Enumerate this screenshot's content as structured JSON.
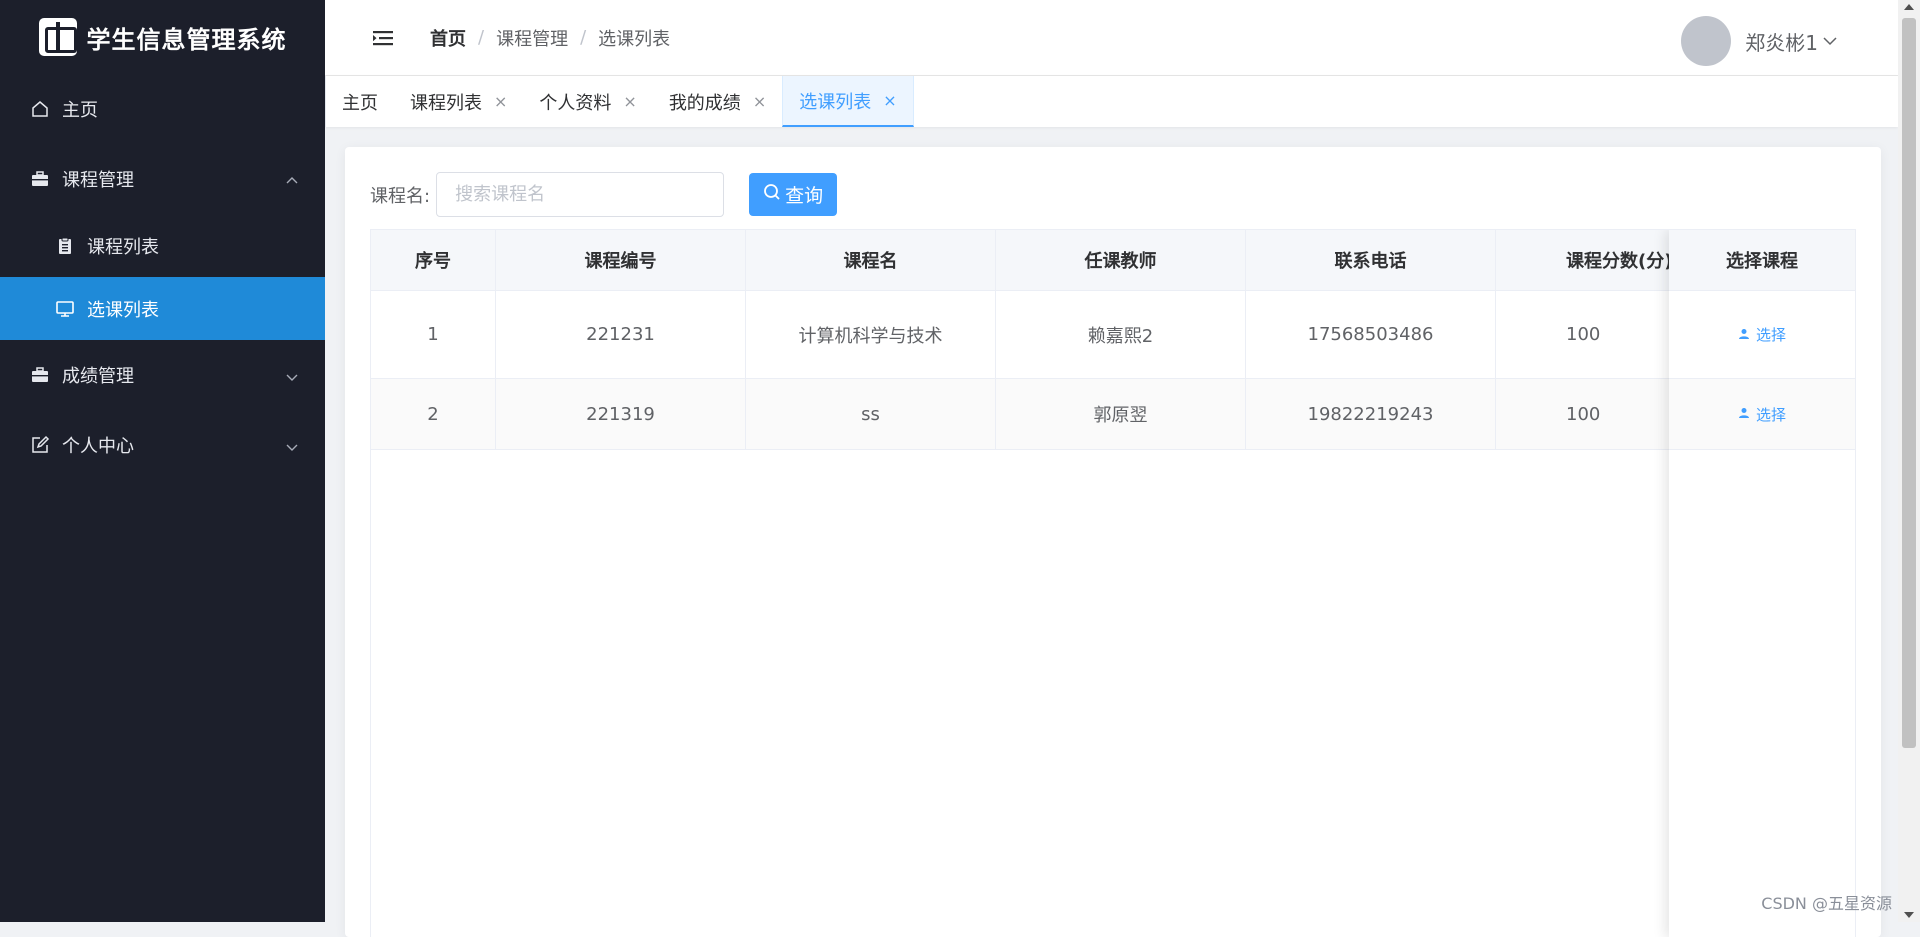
{
  "app": {
    "title": "学生信息管理系统",
    "logo_icon": "school-logo-icon"
  },
  "sidebar": {
    "items": [
      {
        "label": "主页",
        "icon": "home-icon"
      },
      {
        "label": "课程管理",
        "icon": "briefcase-icon",
        "expanded": true,
        "children": [
          {
            "label": "课程列表",
            "icon": "clipboard-icon"
          },
          {
            "label": "选课列表",
            "icon": "monitor-icon",
            "active": true
          }
        ]
      },
      {
        "label": "成绩管理",
        "icon": "briefcase-icon",
        "expanded": false
      },
      {
        "label": "个人中心",
        "icon": "edit-icon",
        "expanded": false
      }
    ]
  },
  "header": {
    "breadcrumb": [
      "首页",
      "课程管理",
      "选课列表"
    ],
    "separator": "/",
    "user_name": "郑炎彬1"
  },
  "tabs": [
    {
      "label": "主页",
      "closable": false
    },
    {
      "label": "课程列表",
      "closable": true
    },
    {
      "label": "个人资料",
      "closable": true
    },
    {
      "label": "我的成绩",
      "closable": true
    },
    {
      "label": "选课列表",
      "closable": true,
      "active": true
    }
  ],
  "tab_close_glyph": "×",
  "search": {
    "label": "课程名:",
    "placeholder": "搜索课程名",
    "value": "",
    "button_label": "查询"
  },
  "table": {
    "headers": [
      "序号",
      "课程编号",
      "课程名",
      "任课教师",
      "联系电话",
      "课程分数(分)",
      "选择课程"
    ],
    "rows": [
      {
        "index": "1",
        "code": "221231",
        "name": "计算机科学与技术",
        "teacher": "赖嘉熙2",
        "phone": "17568503486",
        "score": "100",
        "action": "选择"
      },
      {
        "index": "2",
        "code": "221319",
        "name": "ss",
        "teacher": "郭原翌",
        "phone": "19822219243",
        "score": "100",
        "action": "选择"
      }
    ]
  },
  "watermark": "CSDN @五星资源",
  "colors": {
    "sidebar_bg": "#1c1f2b",
    "sidebar_active": "#1f8ad8",
    "primary": "#409eff",
    "page_bg": "#f0f2f5"
  }
}
